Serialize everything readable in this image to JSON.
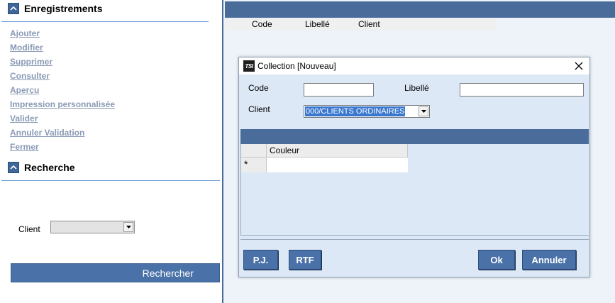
{
  "left_panel": {
    "enregistrements": {
      "title": "Enregistrements",
      "items": [
        "Ajouter",
        "Modifier",
        "Supprimer",
        "Consulter",
        "Aperçu",
        "Impression personnalisée",
        "Valider",
        "Annuler Validation",
        "Fermer"
      ]
    },
    "recherche": {
      "title": "Recherche",
      "client_label": "Client",
      "client_value": "",
      "search_button": "Rechercher"
    }
  },
  "list_columns": [
    "Code",
    "Libellé",
    "Client"
  ],
  "dialog": {
    "title": "Collection [Nouveau]",
    "logo_text": "TSI",
    "code_label": "Code",
    "code_value": "",
    "libelle_label": "Libellé",
    "libelle_value": "",
    "client_label": "Client",
    "client_value": "000/CLIENTS ORDINAIRES",
    "grid": {
      "columns": [
        "Couleur"
      ],
      "new_row_marker": "*"
    },
    "buttons": {
      "pj": "P.J.",
      "rtf": "RTF",
      "ok": "Ok",
      "annuler": "Annuler"
    }
  },
  "colors": {
    "accent_blue": "#4a6c9b",
    "button_blue": "#4a72a8",
    "dialog_bg": "#dde8f6",
    "link_gray": "#8a9ab5"
  }
}
